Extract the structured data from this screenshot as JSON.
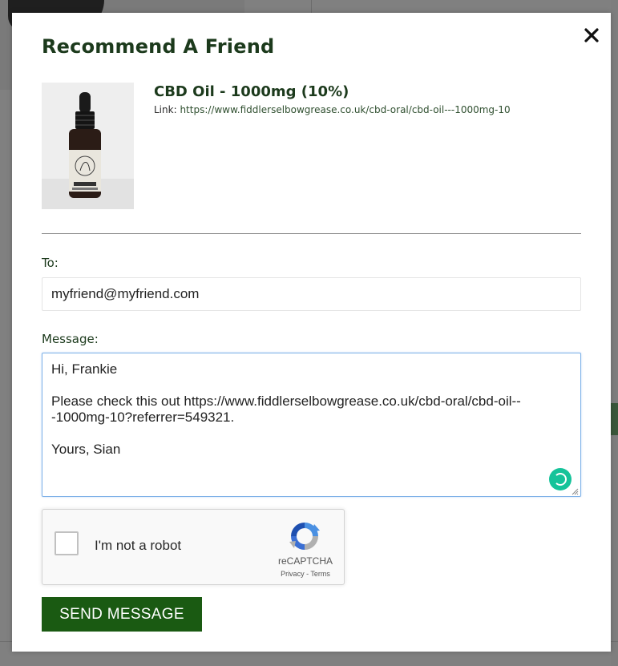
{
  "modal": {
    "title": "Recommend A Friend",
    "close_icon": "close-icon"
  },
  "product": {
    "name": "CBD Oil - 1000mg (10%)",
    "link_label": "Link:",
    "link_url": "https://www.fiddlerselbowgrease.co.uk/cbd-oral/cbd-oil---1000mg-10",
    "image_icon": "product-bottle-image"
  },
  "form": {
    "to_label": "To:",
    "to_value": "myfriend@myfriend.com",
    "message_label": "Message:",
    "message_value": "Hi, Frankie\n\nPlease check this out https://www.fiddlerselbowgrease.co.uk/cbd-oral/cbd-oil---1000mg-10?referrer=549321.\n\nYours, Sian",
    "grammarly_icon": "grammarly-icon"
  },
  "recaptcha": {
    "label": "I'm not a robot",
    "brand": "reCAPTCHA",
    "privacy": "Privacy",
    "separator": " - ",
    "terms": "Terms",
    "checked": false
  },
  "buttons": {
    "send_label": "SEND MESSAGE"
  },
  "colors": {
    "title": "#1c3a1c",
    "send_button": "#1a5a12",
    "overlay": "#808080",
    "grammarly": "#15c39a"
  }
}
